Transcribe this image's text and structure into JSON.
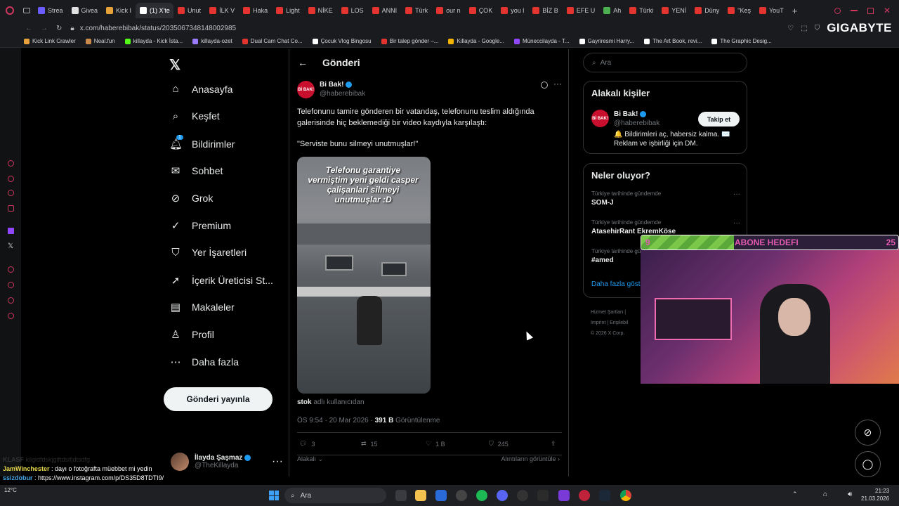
{
  "browser": {
    "tabs": [
      {
        "label": "Strea",
        "color": "#6b5cff"
      },
      {
        "label": "Givea",
        "color": "#e0e0e0"
      },
      {
        "label": "Kick I",
        "color": "#e8a23a"
      },
      {
        "label": "(1) X'te",
        "color": "#ffffff",
        "active": true
      },
      {
        "label": "Unut",
        "color": "#e3342f"
      },
      {
        "label": "İLK V",
        "color": "#e3342f"
      },
      {
        "label": "Haka",
        "color": "#e3342f"
      },
      {
        "label": "Light",
        "color": "#e3342f"
      },
      {
        "label": "NİKE",
        "color": "#e3342f"
      },
      {
        "label": "LOS",
        "color": "#e3342f"
      },
      {
        "label": "ANNI",
        "color": "#e3342f"
      },
      {
        "label": "Türk",
        "color": "#e3342f"
      },
      {
        "label": "our n",
        "color": "#e3342f"
      },
      {
        "label": "ÇOK",
        "color": "#e3342f"
      },
      {
        "label": "you l",
        "color": "#e3342f"
      },
      {
        "label": "BİZ B",
        "color": "#e3342f"
      },
      {
        "label": "EFE U",
        "color": "#e3342f"
      },
      {
        "label": "Ah",
        "color": "#4caf50"
      },
      {
        "label": "Türki",
        "color": "#e3342f"
      },
      {
        "label": "YENİ",
        "color": "#e3342f"
      },
      {
        "label": "Düny",
        "color": "#e3342f"
      },
      {
        "label": "\"Keş",
        "color": "#e3342f"
      },
      {
        "label": "YouT",
        "color": "#e3342f"
      }
    ],
    "url": "x.com/haberebibak/status/2035067348148002985",
    "brand_overlay": "GIGABYTE",
    "bookmarks": [
      {
        "label": "Kick Link Crawler",
        "color": "#e8a23a"
      },
      {
        "label": "Neal.fun",
        "color": "#c98b4a"
      },
      {
        "label": "killayda - Kick İsta...",
        "color": "#53fc18"
      },
      {
        "label": "killayda-ozet",
        "color": "#9b7cff"
      },
      {
        "label": "Dual Cam Chat Co...",
        "color": "#e3342f"
      },
      {
        "label": "Çocuk Vlog Bingosu",
        "color": "#ffffff"
      },
      {
        "label": "Bir talep gönder –...",
        "color": "#e3342f"
      },
      {
        "label": "Killayda - Google...",
        "color": "#f4b400"
      },
      {
        "label": "Müneccilayda - T...",
        "color": "#9146ff"
      },
      {
        "label": "Gayriresmi Harry...",
        "color": "#ffffff"
      },
      {
        "label": "The Art Book, revi...",
        "color": "#ffffff"
      },
      {
        "label": "The Graphic Desig...",
        "color": "#ffffff"
      }
    ]
  },
  "nav": {
    "items": [
      {
        "label": "Anasayfa",
        "icon": "home-icon"
      },
      {
        "label": "Keşfet",
        "icon": "search-icon"
      },
      {
        "label": "Bildirimler",
        "icon": "bell-icon",
        "badge": "1"
      },
      {
        "label": "Sohbet",
        "icon": "mail-icon"
      },
      {
        "label": "Grok",
        "icon": "grok-icon"
      },
      {
        "label": "Premium",
        "icon": "verified-icon"
      },
      {
        "label": "Yer İşaretleri",
        "icon": "bookmark-icon"
      },
      {
        "label": "İçerik Üreticisi St...",
        "icon": "rocket-icon"
      },
      {
        "label": "Makaleler",
        "icon": "article-icon"
      },
      {
        "label": "Profil",
        "icon": "person-icon"
      },
      {
        "label": "Daha fazla",
        "icon": "more-circle-icon"
      }
    ],
    "post_button": "Gönderi yayınla",
    "account": {
      "name": "İlayda Şaşmaz",
      "handle": "@TheKillayda"
    }
  },
  "post": {
    "header_title": "Gönderi",
    "author_name": "Bi Bak!",
    "author_handle": "@haberebibak",
    "avatar_text": "Bİ BAK!",
    "text1": "Telefonunu tamire gönderen bir vatandaş, telefonunu teslim aldığında galerisinde hiç beklemediği bir video kaydıyla karşılaştı:",
    "text2": "\"Serviste bunu silmeyi unutmuşlar!\"",
    "image_caption": "Telefonu garantiye vermiştim yeni geldi casper çalişanlari silmeyi unutmuşlar :D",
    "source_user": "stok",
    "source_suffix": "adlı kullanıcıdan",
    "timestamp": "ÖS 9:54 · 20 Mar 2026 · ",
    "views": "391 B",
    "views_label": "Görüntülenme",
    "replies": "3",
    "reposts": "15",
    "likes": "1 B",
    "bookmarks": "245",
    "replies_filter": "Alakalı",
    "quotes_link": "Alıntıların görüntüle"
  },
  "right": {
    "search_placeholder": "Ara",
    "people_title": "Alakalı kişiler",
    "person_name": "Bi Bak!",
    "person_handle": "@haberebibak",
    "follow_label": "Takip et",
    "person_bio": "🔔 Bildirimleri aç, habersiz kalma. ✉️ Reklam ve işbirliği için DM.",
    "trends_title": "Neler oluyor?",
    "trends": [
      {
        "context": "Türkiye tarihinde gündemde",
        "name": "SOM-J"
      },
      {
        "context": "Türkiye tarihinde gündemde",
        "name": "AtasehirRant EkremKöse"
      },
      {
        "context": "Türkiye tarihinde gündemde",
        "name": "#amed"
      }
    ],
    "show_more": "Daha fazla göst",
    "footer1": "Hizmet Şartları",
    "footer2": "Imprint",
    "footer3": "Erişilebil",
    "footer4": "© 2026 X Corp."
  },
  "stream": {
    "goal_label": "ABONE HEDEFI",
    "goal_current": "9",
    "goal_target": "25",
    "goal_progress": 0.36
  },
  "chat": [
    {
      "user": "KLASF",
      "text": "kilgidfdskjgiftdsifjdtsdfg"
    },
    {
      "user": "JamWinchester",
      "text": ": dayı o fotoğrafta müebbet mi yedin"
    },
    {
      "user": "ssizdobur",
      "text": ": https://www.instagram.com/p/DS35D8TDTI9/"
    }
  ],
  "taskbar": {
    "weather": "12°C",
    "search": "Ara",
    "time": "21:23",
    "date": "21.03.2026"
  }
}
